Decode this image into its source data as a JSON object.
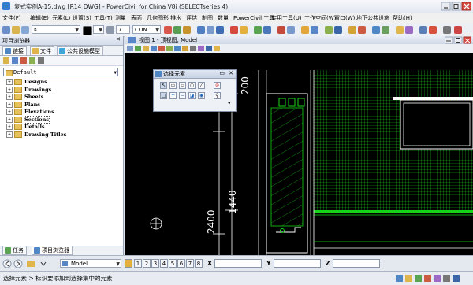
{
  "window": {
    "title": "复式实例A-15.dwg [R14 DWG] - PowerCivil for China V8i (SELECTseries 4)"
  },
  "menu": [
    "文件(F)",
    "编辑(E)",
    "元素(L)",
    "设置(S)",
    "工具(T)",
    "测量",
    "表面",
    "几何图形",
    "排水",
    "评估",
    "制图",
    "数量",
    "PowerCivil 工具",
    "实用工具(U)",
    "工作空间(W)",
    "窗口(W)",
    "地下公共设施",
    "帮助(H)"
  ],
  "toolbar": {
    "active_level": "K",
    "line_weight": "7",
    "line_style": "CON"
  },
  "left_panel": {
    "title": "项目浏览器",
    "tabs": [
      "链接",
      "文件",
      "公共设施模型"
    ],
    "combo_value": "Default",
    "tree": [
      "Designs",
      "Drawings",
      "Sheets",
      "Plans",
      "Elevations",
      "Sections",
      "Details",
      "Drawing Titles"
    ],
    "bottom_tabs": [
      "任务",
      "项目浏览器"
    ]
  },
  "view": {
    "title": "视图 1 - 顶视图, Model",
    "dim_labels": [
      "200",
      "1440",
      "2400"
    ]
  },
  "popup": {
    "title": "选择元素"
  },
  "bottom": {
    "model_combo": "Model",
    "view_numbers": [
      "1",
      "2",
      "3",
      "4",
      "5",
      "6",
      "7",
      "8"
    ],
    "x_label": "X",
    "y_label": "Y",
    "z_label": "Z"
  },
  "status": {
    "text": "选择元素 > 标识要添加到选择集中的元素"
  },
  "colors": {
    "accent": "#2f7fd0",
    "cad_green": "#17d317",
    "cad_white": "#ffffff"
  }
}
